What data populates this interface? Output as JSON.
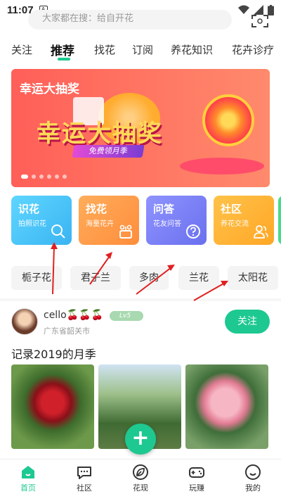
{
  "status": {
    "time": "11:07",
    "a_label": "A"
  },
  "search": {
    "placeholder": "大家都在搜：给自开花"
  },
  "tabs": [
    {
      "label": "关注"
    },
    {
      "label": "推荐"
    },
    {
      "label": "找花"
    },
    {
      "label": "订阅"
    },
    {
      "label": "养花知识"
    },
    {
      "label": "花卉诊疗"
    }
  ],
  "banner": {
    "small_title": "幸运大抽奖",
    "big_title": "幸运大抽奖",
    "ribbon": "免费领月季",
    "page_count": 6,
    "active_page": 1
  },
  "cards": [
    {
      "title": "识花",
      "subtitle": "拍照识花",
      "color": "#4dc8f5",
      "icon": "search-icon"
    },
    {
      "title": "找花",
      "subtitle": "海量花卉",
      "color": "#ff9a4e",
      "icon": "plant-icon"
    },
    {
      "title": "问答",
      "subtitle": "花友问答",
      "color": "#7b80f5",
      "icon": "question-icon"
    },
    {
      "title": "社区",
      "subtitle": "养花交流",
      "color": "#ffb535",
      "icon": "people-icon"
    }
  ],
  "chips": [
    {
      "label": "栀子花"
    },
    {
      "label": "君子兰"
    },
    {
      "label": "多肉"
    },
    {
      "label": "兰花"
    },
    {
      "label": "太阳花"
    }
  ],
  "post": {
    "username": "cello🍒🍒🍒",
    "level": "Lv5",
    "location": "广东省韶关市",
    "follow_label": "关注",
    "title": "记录2019的月季"
  },
  "fab": {
    "label": "+"
  },
  "nav": [
    {
      "label": "首页",
      "icon": "home-icon"
    },
    {
      "label": "社区",
      "icon": "chat-icon"
    },
    {
      "label": "花现",
      "icon": "leaf-icon"
    },
    {
      "label": "玩赚",
      "icon": "gamepad-icon"
    },
    {
      "label": "我的",
      "icon": "smile-icon"
    }
  ],
  "colors": {
    "accent": "#1ec891",
    "annotation": "#e02020"
  }
}
